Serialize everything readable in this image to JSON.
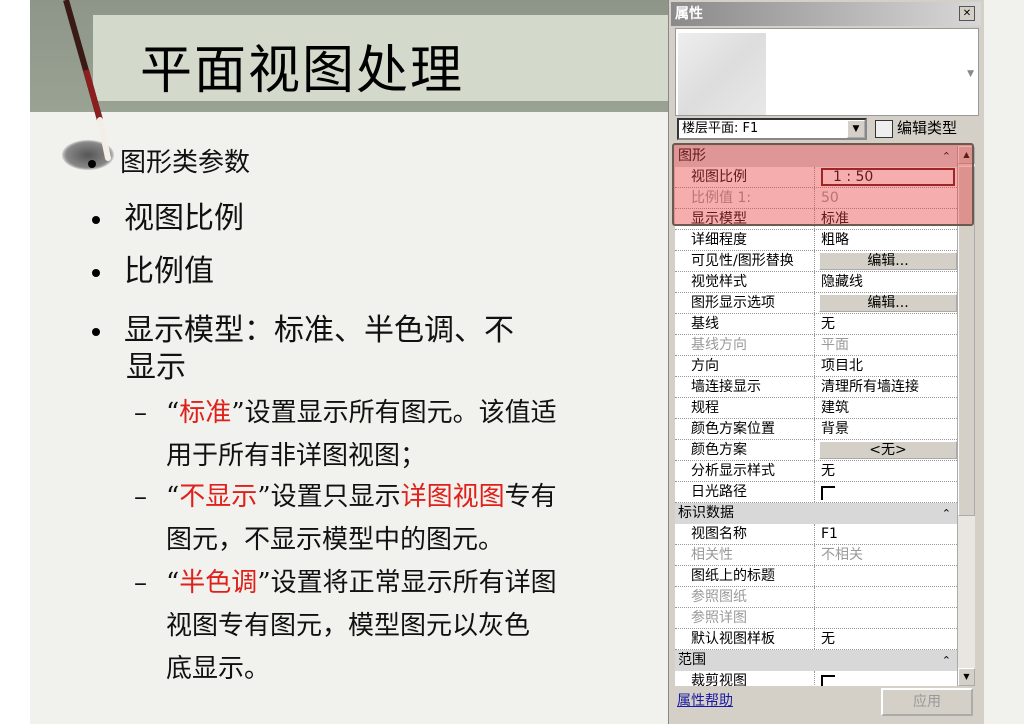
{
  "slide": {
    "title": "平面视图处理",
    "bullets": [
      "图形类参数",
      "视图比例",
      "比例值",
      "显示模型：标准、半色调、不",
      "显示"
    ],
    "subitems": [
      {
        "lines": [
          [
            {
              "t": "“",
              "r": false
            },
            {
              "t": "标准",
              "r": true
            },
            {
              "t": "”设置显示所有图元。该值适",
              "r": false
            }
          ],
          [
            {
              "t": "用于所有非详图视图；",
              "r": false
            }
          ]
        ]
      },
      {
        "lines": [
          [
            {
              "t": "“",
              "r": false
            },
            {
              "t": "不显示",
              "r": true
            },
            {
              "t": "”设置只显示",
              "r": false
            },
            {
              "t": "详图视图",
              "r": true
            },
            {
              "t": "专有",
              "r": false
            }
          ],
          [
            {
              "t": "图元，不显示模型中的图元。",
              "r": false
            }
          ]
        ]
      },
      {
        "lines": [
          [
            {
              "t": "“",
              "r": false
            },
            {
              "t": "半色调",
              "r": true
            },
            {
              "t": "”设置将正常显示所有详图",
              "r": false
            }
          ],
          [
            {
              "t": "视图专有图元，模型图元以灰色",
              "r": false
            }
          ],
          [
            {
              "t": "底显示。",
              "r": false
            }
          ]
        ]
      }
    ],
    "dash": "–",
    "highlight_color": "#e0201a"
  },
  "panel": {
    "title": "属性",
    "close": "✕",
    "type_selector": "楼层平面: F1",
    "edit_type": "编辑类型",
    "groups": [
      {
        "name": "图形",
        "rows": [
          {
            "n": "视图比例",
            "v": "1 : 50",
            "kind": "scale"
          },
          {
            "n": "比例值 1:",
            "v": "50",
            "dis": true
          },
          {
            "n": "显示模型",
            "v": "标准"
          },
          {
            "n": "详细程度",
            "v": "粗略"
          },
          {
            "n": "可见性/图形替换",
            "v": "编辑...",
            "kind": "btn"
          },
          {
            "n": "视觉样式",
            "v": "隐藏线"
          },
          {
            "n": "图形显示选项",
            "v": "编辑...",
            "kind": "btn"
          },
          {
            "n": "基线",
            "v": "无"
          },
          {
            "n": "基线方向",
            "v": "平面",
            "dis": true
          },
          {
            "n": "方向",
            "v": "项目北"
          },
          {
            "n": "墙连接显示",
            "v": "清理所有墙连接"
          },
          {
            "n": "规程",
            "v": "建筑"
          },
          {
            "n": "颜色方案位置",
            "v": "背景"
          },
          {
            "n": "颜色方案",
            "v": "<无>",
            "kind": "btn"
          },
          {
            "n": "分析显示样式",
            "v": "无"
          },
          {
            "n": "日光路径",
            "v": "",
            "kind": "chk"
          }
        ]
      },
      {
        "name": "标识数据",
        "rows": [
          {
            "n": "视图名称",
            "v": "F1"
          },
          {
            "n": "相关性",
            "v": "不相关",
            "dis": true
          },
          {
            "n": "图纸上的标题",
            "v": ""
          },
          {
            "n": "参照图纸",
            "v": "",
            "dis": true
          },
          {
            "n": "参照详图",
            "v": "",
            "dis": true
          },
          {
            "n": "默认视图样板",
            "v": "无"
          }
        ]
      },
      {
        "name": "范围",
        "rows": [
          {
            "n": "裁剪视图",
            "v": "",
            "kind": "chk"
          }
        ]
      }
    ],
    "help_link": "属性帮助",
    "apply": "应用"
  }
}
